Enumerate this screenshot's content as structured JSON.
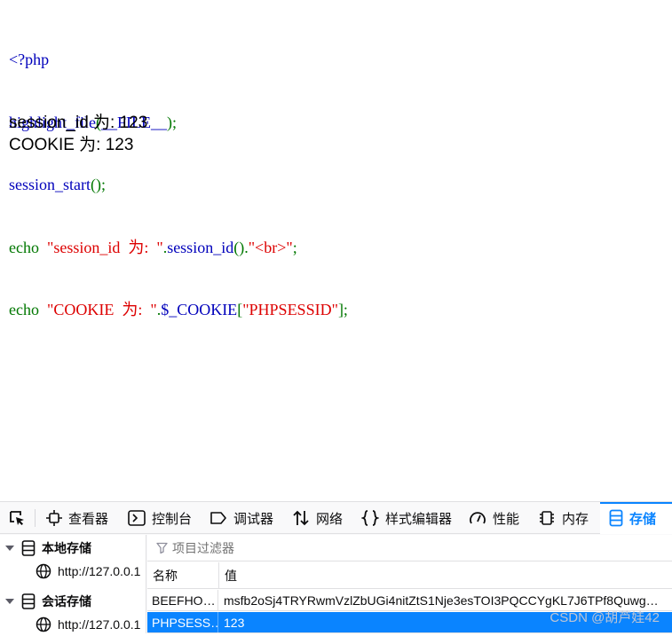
{
  "code": {
    "line1": "<?php",
    "line2_fn": "highlight_file",
    "line2_paren_open": "(",
    "line2_arg": "__FILE__",
    "line2_end": ");",
    "line3_fn": "session_start",
    "line3_end": "();",
    "line4_echo": "echo  ",
    "line4_str1": "\"session_id  为:  \"",
    "line4_dot1": ".",
    "line4_fn": "session_id",
    "line4_call": "().",
    "line4_str2": "\"<br>\"",
    "line4_end": ";",
    "line5_echo": "echo  ",
    "line5_str1": "\"COOKIE  为:  \"",
    "line5_dot": ".",
    "line5_var": "$_COOKIE",
    "line5_bracket_open": "[",
    "line5_key": "\"PHPSESSID\"",
    "line5_end": "];"
  },
  "output": {
    "line1": "session_id 为: 123",
    "line2": "COOKIE 为: 123"
  },
  "devtools": {
    "tabs": [
      {
        "label": "查看器",
        "icon": "inspector-icon"
      },
      {
        "label": "控制台",
        "icon": "console-icon"
      },
      {
        "label": "调试器",
        "icon": "debugger-icon"
      },
      {
        "label": "网络",
        "icon": "network-icon"
      },
      {
        "label": "样式编辑器",
        "icon": "style-editor-icon"
      },
      {
        "label": "性能",
        "icon": "performance-icon"
      },
      {
        "label": "内存",
        "icon": "memory-icon"
      },
      {
        "label": "存储",
        "icon": "storage-icon"
      }
    ],
    "active_tab": "存储",
    "sidebar": {
      "local_storage": "本地存储",
      "local_url": "http://127.0.0.1",
      "session_storage": "会话存储",
      "session_url": "http://127.0.0.1"
    },
    "filter_placeholder": "项目过滤器",
    "table": {
      "headers": [
        "名称",
        "值"
      ],
      "rows": [
        {
          "name": "BEEFHO…",
          "value": "msfb2oSj4TRYRwmVzlZbUGi4nitZtS1Nje3esTOI3PQCCYgKL7J6TPf8Quwg…"
        },
        {
          "name": "PHPSESS…",
          "value": "123"
        }
      ],
      "selected_row": 1
    }
  },
  "watermark": "CSDN @胡芦娃42",
  "colors": {
    "php_default": "#0000bb",
    "php_keyword": "#007700",
    "php_string": "#dd0000",
    "accent": "#0a84ff"
  }
}
